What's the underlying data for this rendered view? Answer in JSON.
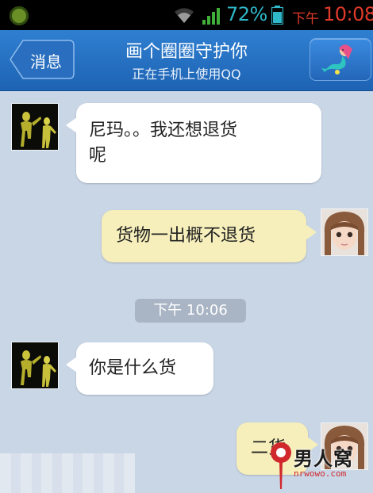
{
  "status_bar": {
    "battery_percent": "72%",
    "ampm": "下午",
    "time": "10:08",
    "colors": {
      "battery_text": "#2fb8c9",
      "clock_text": "#e03a2a"
    }
  },
  "title_bar": {
    "back_label": "消息",
    "title": "画个圈圈守护你",
    "subtitle": "正在手机上使用QQ",
    "colors": {
      "background": "#2a75c8"
    }
  },
  "chat": {
    "messages": [
      {
        "direction": "incoming",
        "lines": [
          "尼玛。。我还想退货",
          "呢"
        ]
      },
      {
        "direction": "outgoing",
        "lines": [
          "货物一出概不退货"
        ]
      },
      {
        "direction": "incoming",
        "lines": [
          "你是什么货"
        ]
      },
      {
        "direction": "outgoing",
        "lines": [
          "二货"
        ]
      }
    ],
    "timestamp": "下午 10:06",
    "colors": {
      "incoming_bubble": "#ffffff",
      "outgoing_bubble": "#f6efbb",
      "background": "#c9d6e6"
    }
  },
  "watermark": {
    "title": "男人窝",
    "url": "nrwowo.com"
  },
  "icons": {
    "back": "back-arrow-icon",
    "profile": "mermaid-avatar-icon",
    "status_app": "app-notification-icon",
    "wifi": "wifi-icon",
    "signal": "signal-icon",
    "battery": "battery-icon"
  }
}
